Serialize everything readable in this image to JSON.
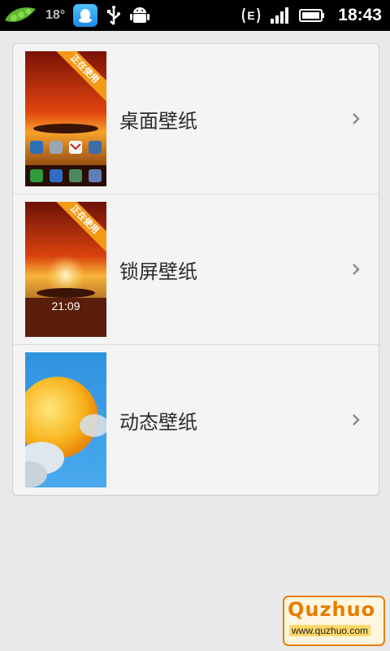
{
  "status_bar": {
    "temperature": "18°",
    "network_type": "E",
    "time": "18:43"
  },
  "wallpaper_list": {
    "items": [
      {
        "label": "桌面壁纸",
        "badge": "正在使用",
        "kind": "home"
      },
      {
        "label": "锁屏壁纸",
        "badge": "正在使用",
        "kind": "lock",
        "clock": "21:09"
      },
      {
        "label": "动态壁纸",
        "badge": "",
        "kind": "live"
      }
    ]
  },
  "watermark": {
    "title": "Quzhuo",
    "url": "www.quzhuo.com"
  }
}
